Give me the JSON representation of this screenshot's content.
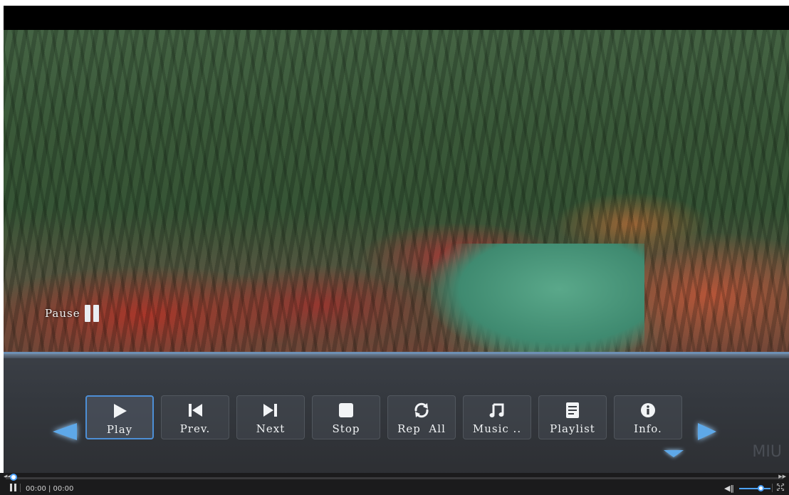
{
  "osd": {
    "pause_label": "Pause"
  },
  "menu": {
    "buttons": [
      {
        "label": "Play",
        "icon": "play-icon",
        "selected": true
      },
      {
        "label": "Prev.",
        "icon": "previous-icon",
        "selected": false
      },
      {
        "label": "Next",
        "icon": "next-icon",
        "selected": false
      },
      {
        "label": "Stop",
        "icon": "stop-icon",
        "selected": false
      },
      {
        "label": "Rep  All",
        "icon": "repeat-icon",
        "selected": false
      },
      {
        "label": "Music ..",
        "icon": "music-note-icon",
        "selected": false
      },
      {
        "label": "Playlist",
        "icon": "playlist-icon",
        "selected": false
      },
      {
        "label": "Info.",
        "icon": "info-icon",
        "selected": false
      }
    ]
  },
  "watermark": "MIU",
  "player_bar": {
    "time": "00:00 | 00:00",
    "seek_progress": 0.0,
    "volume_level": 0.7
  },
  "colors": {
    "accent": "#4da3ff",
    "selected_border": "#4d8fd6",
    "arrow": "#5ea8e8"
  }
}
